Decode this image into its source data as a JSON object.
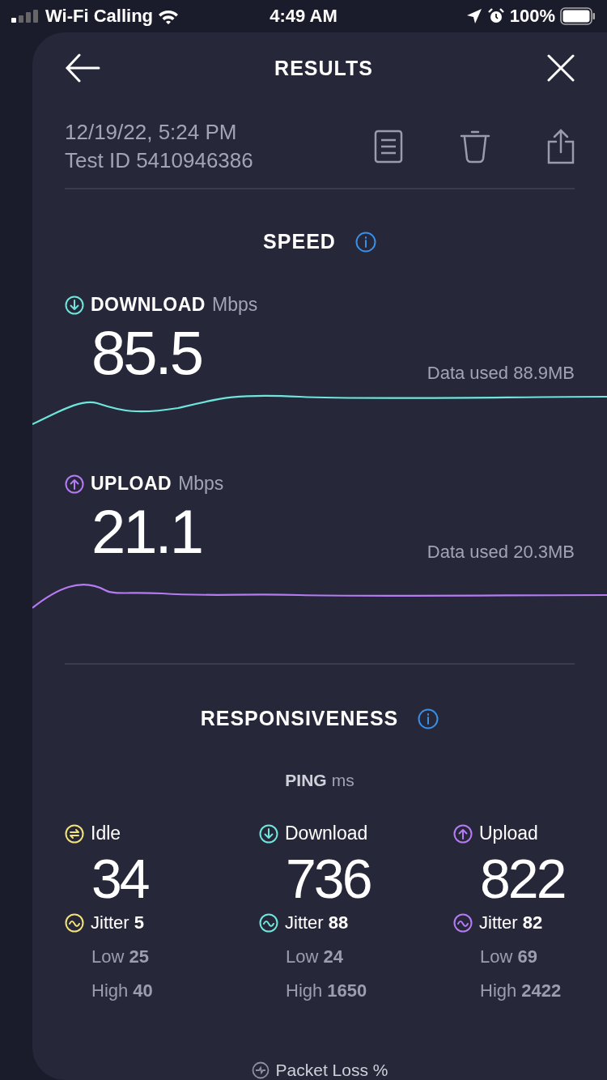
{
  "status_bar": {
    "carrier": "Wi-Fi Calling",
    "time": "4:49 AM",
    "battery": "100%"
  },
  "header": {
    "title": "RESULTS"
  },
  "test": {
    "date": "12/19/22, 5:24 PM",
    "test_id": "Test ID 5410946386"
  },
  "speed": {
    "title": "SPEED",
    "metrics": [
      {
        "kind": "download",
        "label": "DOWNLOAD",
        "unit": "Mbps",
        "value": "85.5",
        "data_used": "Data used 88.9MB",
        "color": "#6fe5dc"
      },
      {
        "kind": "upload",
        "label": "UPLOAD",
        "unit": "Mbps",
        "value": "21.1",
        "data_used": "Data used 20.3MB",
        "color": "#b57bf2"
      }
    ]
  },
  "responsiveness": {
    "title": "RESPONSIVENESS",
    "ping": {
      "label": "PING",
      "unit": "ms"
    },
    "columns": [
      {
        "kind": "idle",
        "label": "Idle",
        "value": "34",
        "jitter": "Jitter **5**",
        "low": "Low **25**",
        "high": "High **40**",
        "color": "#f2e27a"
      },
      {
        "kind": "download",
        "label": "Download",
        "value": "736",
        "jitter": "Jitter **88**",
        "low": "Low **24**",
        "high": "High **1650**",
        "color": "#6fe5dc"
      },
      {
        "kind": "upload",
        "label": "Upload",
        "value": "822",
        "jitter": "Jitter **82**",
        "low": "Low **69**",
        "high": "High **2422**",
        "color": "#b57bf2"
      }
    ]
  },
  "packet_loss": {
    "label": "Packet Loss",
    "unit": "%"
  }
}
